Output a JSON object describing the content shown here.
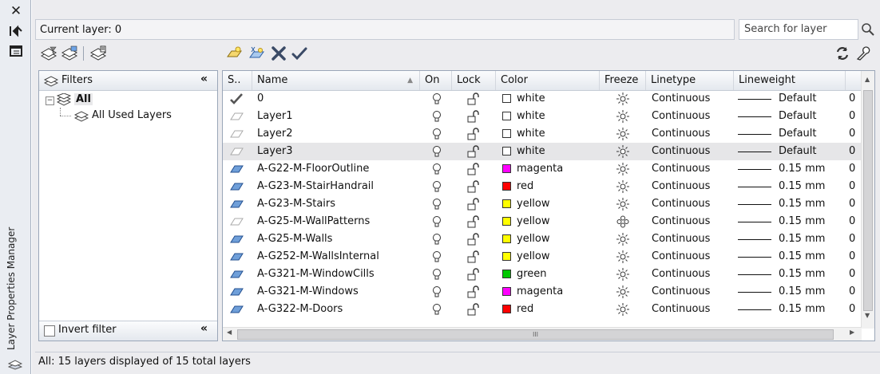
{
  "palette": "Layer Properties Manager",
  "current_layer_label": "Current layer: 0",
  "search_placeholder": "Search for layer",
  "filters": {
    "header": "Filters",
    "tree_root": "All",
    "tree_child": "All Used Layers",
    "invert_filter_label": "Invert filter",
    "invert_filter_checked": false
  },
  "columns": [
    "S..",
    "Name",
    "On",
    "Lock",
    "Color",
    "Freeze",
    "Linetype",
    "Lineweight"
  ],
  "layers": [
    {
      "name": "0",
      "on": "on",
      "lock": "unlocked",
      "color_name": "white",
      "color_hex": "#ffffff",
      "freeze": "thawed",
      "linetype": "Continuous",
      "lineweight": "Default",
      "extra": "0",
      "status": "current"
    },
    {
      "name": "Layer1",
      "on": "on",
      "lock": "unlocked",
      "color_name": "white",
      "color_hex": "#ffffff",
      "freeze": "thawed",
      "linetype": "Continuous",
      "lineweight": "Default",
      "extra": "0",
      "status": "unused"
    },
    {
      "name": "Layer2",
      "on": "on",
      "lock": "unlocked",
      "color_name": "white",
      "color_hex": "#ffffff",
      "freeze": "thawed",
      "linetype": "Continuous",
      "lineweight": "Default",
      "extra": "0",
      "status": "unused"
    },
    {
      "name": "Layer3",
      "on": "on",
      "lock": "unlocked",
      "color_name": "white",
      "color_hex": "#ffffff",
      "freeze": "thawed",
      "linetype": "Continuous",
      "lineweight": "Default",
      "extra": "0",
      "status": "unused",
      "selected": true
    },
    {
      "name": "A-G22-M-FloorOutline",
      "on": "on",
      "lock": "unlocked",
      "color_name": "magenta",
      "color_hex": "#ff00ff",
      "freeze": "thawed",
      "linetype": "Continuous",
      "lineweight": "0.15 mm",
      "extra": "0",
      "status": "used"
    },
    {
      "name": "A-G23-M-StairHandrail",
      "on": "on",
      "lock": "unlocked",
      "color_name": "red",
      "color_hex": "#ff0000",
      "freeze": "thawed",
      "linetype": "Continuous",
      "lineweight": "0.15 mm",
      "extra": "0",
      "status": "used"
    },
    {
      "name": "A-G23-M-Stairs",
      "on": "on",
      "lock": "unlocked",
      "color_name": "yellow",
      "color_hex": "#ffff00",
      "freeze": "thawed",
      "linetype": "Continuous",
      "lineweight": "0.15 mm",
      "extra": "0",
      "status": "used"
    },
    {
      "name": "A-G25-M-WallPatterns",
      "on": "on",
      "lock": "unlocked",
      "color_name": "yellow",
      "color_hex": "#ffff00",
      "freeze": "frozen",
      "linetype": "Continuous",
      "lineweight": "0.15 mm",
      "extra": "0",
      "status": "unused"
    },
    {
      "name": "A-G25-M-Walls",
      "on": "on",
      "lock": "unlocked",
      "color_name": "yellow",
      "color_hex": "#ffff00",
      "freeze": "thawed",
      "linetype": "Continuous",
      "lineweight": "0.15 mm",
      "extra": "0",
      "status": "used"
    },
    {
      "name": "A-G252-M-WallsInternal",
      "on": "on",
      "lock": "unlocked",
      "color_name": "yellow",
      "color_hex": "#ffff00",
      "freeze": "thawed",
      "linetype": "Continuous",
      "lineweight": "0.15 mm",
      "extra": "0",
      "status": "used"
    },
    {
      "name": "A-G321-M-WindowCills",
      "on": "on",
      "lock": "unlocked",
      "color_name": "green",
      "color_hex": "#00c800",
      "freeze": "thawed",
      "linetype": "Continuous",
      "lineweight": "0.15 mm",
      "extra": "0",
      "status": "used"
    },
    {
      "name": "A-G321-M-Windows",
      "on": "on",
      "lock": "unlocked",
      "color_name": "magenta",
      "color_hex": "#ff00ff",
      "freeze": "thawed",
      "linetype": "Continuous",
      "lineweight": "0.15 mm",
      "extra": "0",
      "status": "used"
    },
    {
      "name": "A-G322-M-Doors",
      "on": "on",
      "lock": "unlocked",
      "color_name": "red",
      "color_hex": "#ff0000",
      "freeze": "thawed",
      "linetype": "Continuous",
      "lineweight": "0.15 mm",
      "extra": "0",
      "status": "used"
    }
  ],
  "hscroll_thumb_glyph": "III",
  "status_text": "All: 15 layers displayed of 15 total layers"
}
